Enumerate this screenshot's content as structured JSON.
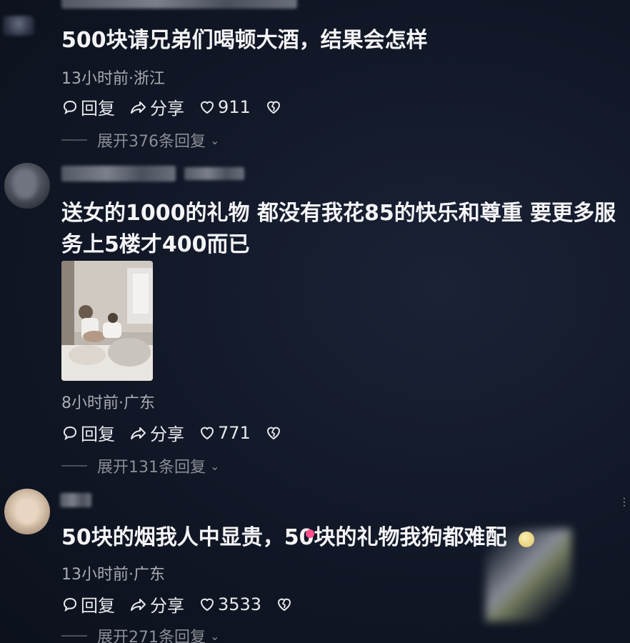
{
  "comments": [
    {
      "text": "500块请兄弟们喝顿大酒，结果会怎样",
      "meta": "13小时前·浙江",
      "reply_label": "回复",
      "share_label": "分享",
      "likes": "911",
      "expand_label": "展开376条回复"
    },
    {
      "text_line1": "送女的1000的礼物 都没有我花85的快乐和尊重 要更多服",
      "text_line2": "务上5楼才400而已",
      "meta": "8小时前·广东",
      "reply_label": "回复",
      "share_label": "分享",
      "likes": "771",
      "expand_label": "展开131条回复"
    },
    {
      "text": "50块的烟我人中显贵，50块的礼物我狗都难配",
      "meta": "13小时前·广东",
      "reply_label": "回复",
      "share_label": "分享",
      "likes": "3533",
      "expand_label": "展开271条回复"
    }
  ],
  "icons": {
    "reply": "speech-bubble-icon",
    "share": "share-arrow-icon",
    "like": "heart-icon",
    "dislike": "broken-heart-icon",
    "expand": "chevron-down-icon"
  },
  "colors": {
    "background": "#111726",
    "text": "#f4f4f6",
    "meta": "#a9abb2",
    "expand": "#8b8e96"
  }
}
